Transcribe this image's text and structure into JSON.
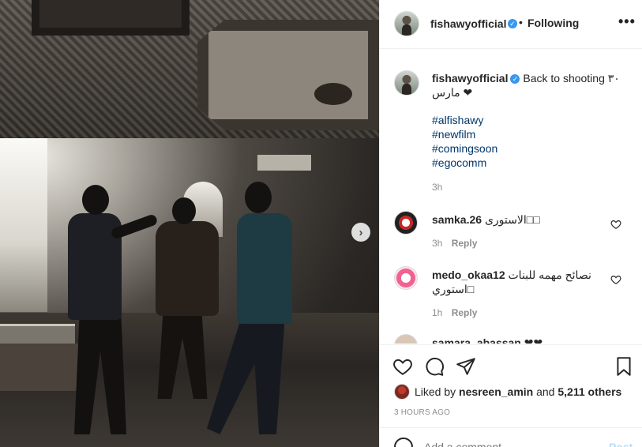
{
  "post": {
    "username": "fishawyofficial",
    "verified_icon": "verified-badge-icon",
    "follow_status": "Following",
    "more_label": "•••"
  },
  "caption": {
    "username": "fishawyofficial",
    "text": "Back to shooting ٣٠ مارس ❤",
    "hashtags": [
      "#alfishawy",
      "#newfilm",
      "#comingsoon",
      "#egocomm"
    ],
    "time": "3h"
  },
  "comments": [
    {
      "username": "samka.26",
      "text": "الاستورى□□",
      "time": "3h",
      "reply": "Reply"
    },
    {
      "username": "medo_okaa12",
      "text": "نصائح مهمه للبنات استوري□",
      "time": "1h",
      "reply": "Reply"
    },
    {
      "username": "samara_abassan",
      "text": "❤❤",
      "time": "",
      "reply": ""
    }
  ],
  "likes": {
    "prefix": "Liked by",
    "user": "nesreen_amin",
    "middle": "and",
    "count": "5,211 others"
  },
  "post_date": "3 HOURS AGO",
  "add_comment": {
    "placeholder": "Add a comment…",
    "post_label": "Post"
  },
  "carousel": {
    "next_glyph": "›"
  }
}
